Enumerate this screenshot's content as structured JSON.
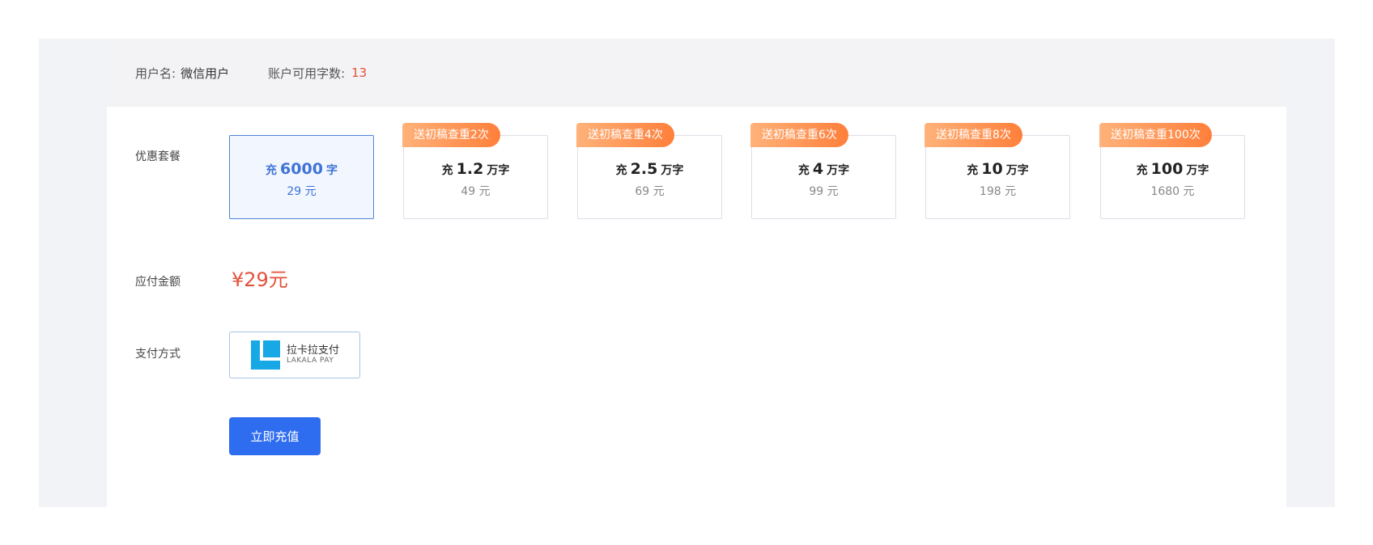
{
  "account": {
    "username_label": "用户名:",
    "username_value": "微信用户",
    "balance_label": "账户可用字数:",
    "balance_value": "13"
  },
  "labels": {
    "package": "优惠套餐",
    "amount_due": "应付金额",
    "payment_method": "支付方式"
  },
  "packages": [
    {
      "prefix": "充",
      "amount": "6000",
      "unit": "字",
      "price": "29 元",
      "badge": "",
      "selected": true
    },
    {
      "prefix": "充",
      "amount": "1.2",
      "unit": "万字",
      "price": "49 元",
      "badge": "送初稿查重2次",
      "selected": false
    },
    {
      "prefix": "充",
      "amount": "2.5",
      "unit": "万字",
      "price": "69 元",
      "badge": "送初稿查重4次",
      "selected": false
    },
    {
      "prefix": "充",
      "amount": "4",
      "unit": "万字",
      "price": "99 元",
      "badge": "送初稿查重6次",
      "selected": false
    },
    {
      "prefix": "充",
      "amount": "10",
      "unit": "万字",
      "price": "198 元",
      "badge": "送初稿查重8次",
      "selected": false
    },
    {
      "prefix": "充",
      "amount": "100",
      "unit": "万字",
      "price": "1680 元",
      "badge": "送初稿查重100次",
      "selected": false
    }
  ],
  "amount_due": "¥29元",
  "payment": {
    "name_cn": "拉卡拉支付",
    "name_en": "LAKALA PAY",
    "icon": "lakala-logo-icon"
  },
  "submit_label": "立即充值",
  "colors": {
    "accent_red": "#e4513a",
    "primary_blue": "#2f6df0",
    "badge_orange": "#ff7f3a",
    "logo_cyan": "#19a8e6"
  }
}
